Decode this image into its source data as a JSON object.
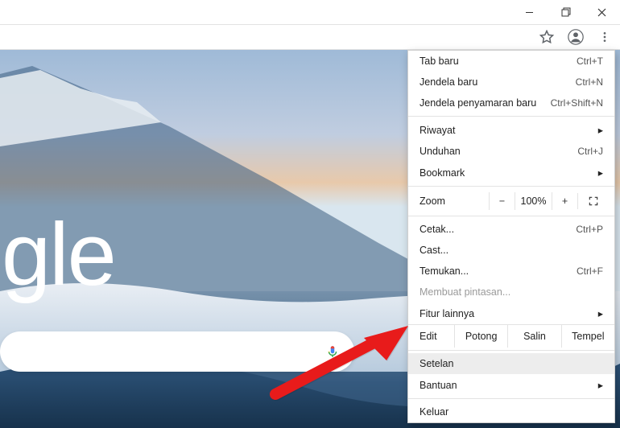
{
  "window_controls": {
    "min": "–",
    "max": "🗗",
    "close": "✕"
  },
  "toolbar": {
    "star": "☆",
    "profile": "●",
    "more": "⋮"
  },
  "page": {
    "logo_fragment": "gle"
  },
  "menu": {
    "new_tab": {
      "label": "Tab baru",
      "shortcut": "Ctrl+T"
    },
    "new_window": {
      "label": "Jendela baru",
      "shortcut": "Ctrl+N"
    },
    "incognito": {
      "label": "Jendela penyamaran baru",
      "shortcut": "Ctrl+Shift+N"
    },
    "history": {
      "label": "Riwayat"
    },
    "downloads": {
      "label": "Unduhan",
      "shortcut": "Ctrl+J"
    },
    "bookmarks": {
      "label": "Bookmark"
    },
    "zoom": {
      "label": "Zoom",
      "value": "100%",
      "minus": "−",
      "plus": "+"
    },
    "print": {
      "label": "Cetak...",
      "shortcut": "Ctrl+P"
    },
    "cast": {
      "label": "Cast..."
    },
    "find": {
      "label": "Temukan...",
      "shortcut": "Ctrl+F"
    },
    "shortcut_create": {
      "label": "Membuat pintasan..."
    },
    "more_tools": {
      "label": "Fitur lainnya"
    },
    "edit": {
      "label": "Edit",
      "cut": "Potong",
      "copy": "Salin",
      "paste": "Tempel"
    },
    "settings": {
      "label": "Setelan"
    },
    "help": {
      "label": "Bantuan"
    },
    "exit": {
      "label": "Keluar"
    }
  }
}
